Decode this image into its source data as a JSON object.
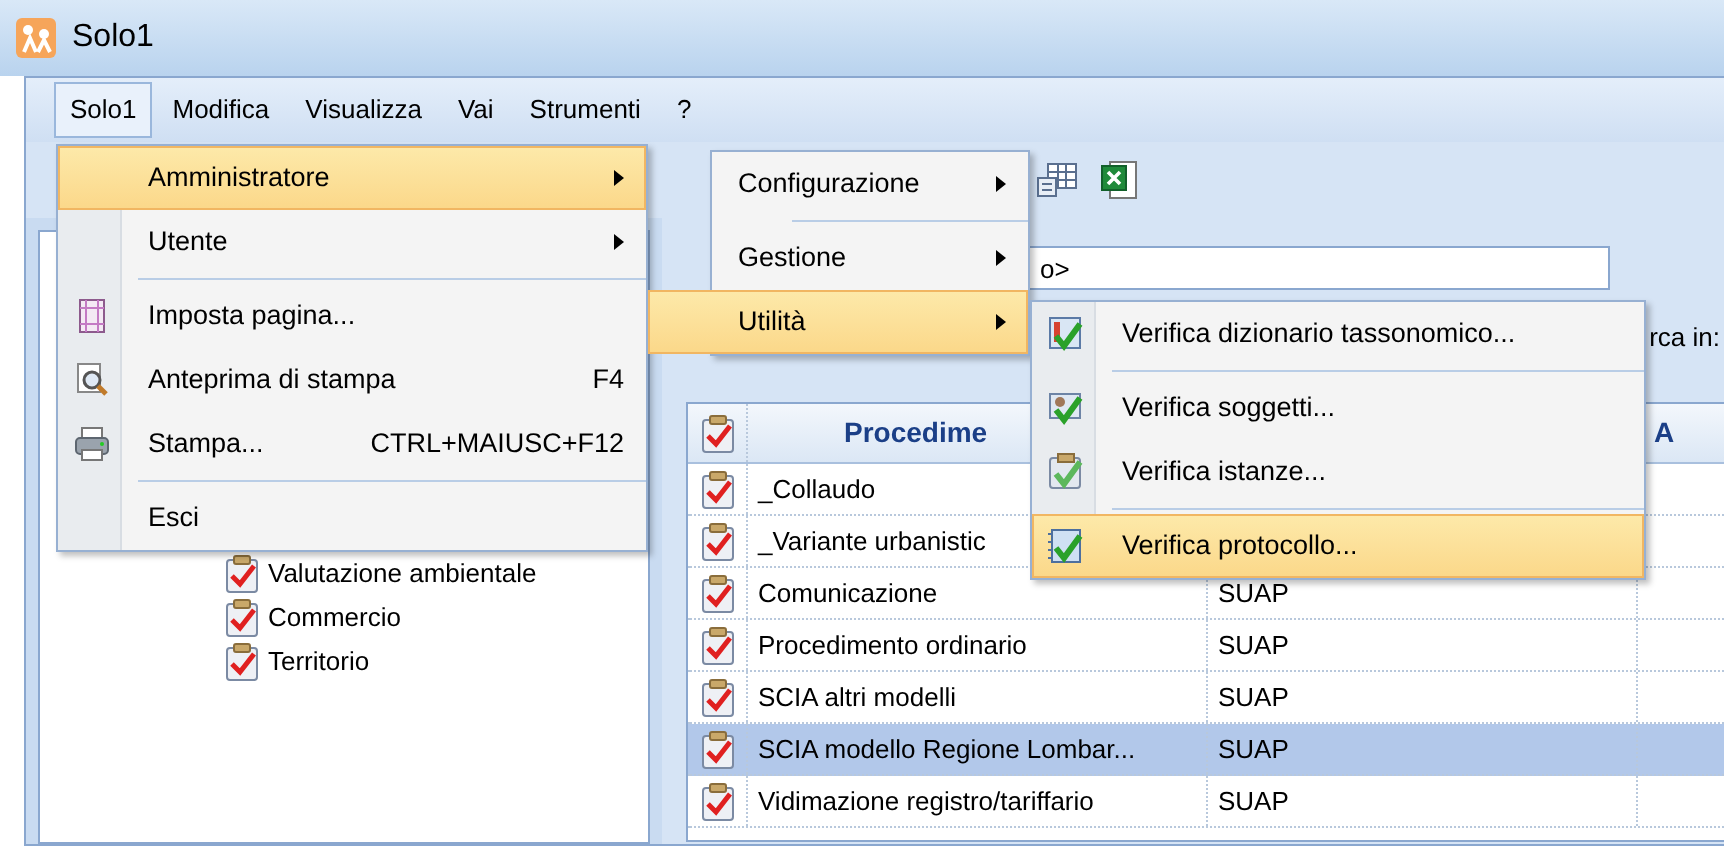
{
  "window": {
    "title": "Solo1"
  },
  "menubar": [
    {
      "label": "Solo1",
      "selected": true
    },
    {
      "label": "Modifica",
      "selected": false
    },
    {
      "label": "Visualizza",
      "selected": false
    },
    {
      "label": "Vai",
      "selected": false
    },
    {
      "label": "Strumenti",
      "selected": false
    },
    {
      "label": "?",
      "selected": false
    }
  ],
  "tree": [
    {
      "label": "Valutazione ambientale"
    },
    {
      "label": "Commercio"
    },
    {
      "label": "Territorio"
    }
  ],
  "filter": {
    "combo_value": "o>",
    "search_in_label": "rca in:"
  },
  "table": {
    "columns": [
      "Procedime",
      "A"
    ],
    "rows": [
      {
        "cells": [
          "_Collaudo"
        ],
        "selected": false
      },
      {
        "cells": [
          "_Variante urbanistic"
        ],
        "selected": false
      },
      {
        "cells": [
          "Comunicazione",
          "SUAP"
        ],
        "selected": false
      },
      {
        "cells": [
          "Procedimento ordinario",
          "SUAP"
        ],
        "selected": false
      },
      {
        "cells": [
          "SCIA altri modelli",
          "SUAP"
        ],
        "selected": false
      },
      {
        "cells": [
          "SCIA modello Regione Lombar...",
          "SUAP"
        ],
        "selected": true
      },
      {
        "cells": [
          "Vidimazione registro/tariffario",
          "SUAP"
        ],
        "selected": false
      }
    ]
  },
  "menus": [
    {
      "items": [
        {
          "kind": "item",
          "label": "Amministratore",
          "submenu": true,
          "selected": true
        },
        {
          "kind": "item",
          "label": "Utente",
          "submenu": true,
          "selected": false
        },
        {
          "kind": "separator"
        },
        {
          "kind": "item",
          "label": "Imposta pagina...",
          "submenu": false,
          "selected": false
        },
        {
          "kind": "item",
          "label": "Anteprima di stampa",
          "shortcut": "F4",
          "submenu": false,
          "selected": false
        },
        {
          "kind": "item",
          "label": "Stampa...",
          "shortcut": "CTRL+MAIUSC+F12",
          "submenu": false,
          "selected": false
        },
        {
          "kind": "separator"
        },
        {
          "kind": "item",
          "label": "Esci",
          "submenu": false,
          "selected": false
        }
      ]
    },
    {
      "items": [
        {
          "kind": "item",
          "label": "Configurazione",
          "submenu": true,
          "selected": false
        },
        {
          "kind": "separator"
        },
        {
          "kind": "item",
          "label": "Gestione",
          "submenu": true,
          "selected": false
        },
        {
          "kind": "item",
          "label": "Utilità",
          "submenu": true,
          "selected": true
        }
      ]
    },
    {
      "items": [
        {
          "kind": "item",
          "label": "Verifica dizionario tassonomico...",
          "submenu": false,
          "selected": false
        },
        {
          "kind": "separator"
        },
        {
          "kind": "item",
          "label": "Verifica soggetti...",
          "submenu": false,
          "selected": false
        },
        {
          "kind": "item",
          "label": "Verifica istanze...",
          "submenu": false,
          "selected": false
        },
        {
          "kind": "separator"
        },
        {
          "kind": "item",
          "label": "Verifica protocollo...",
          "submenu": false,
          "selected": true
        }
      ]
    }
  ]
}
